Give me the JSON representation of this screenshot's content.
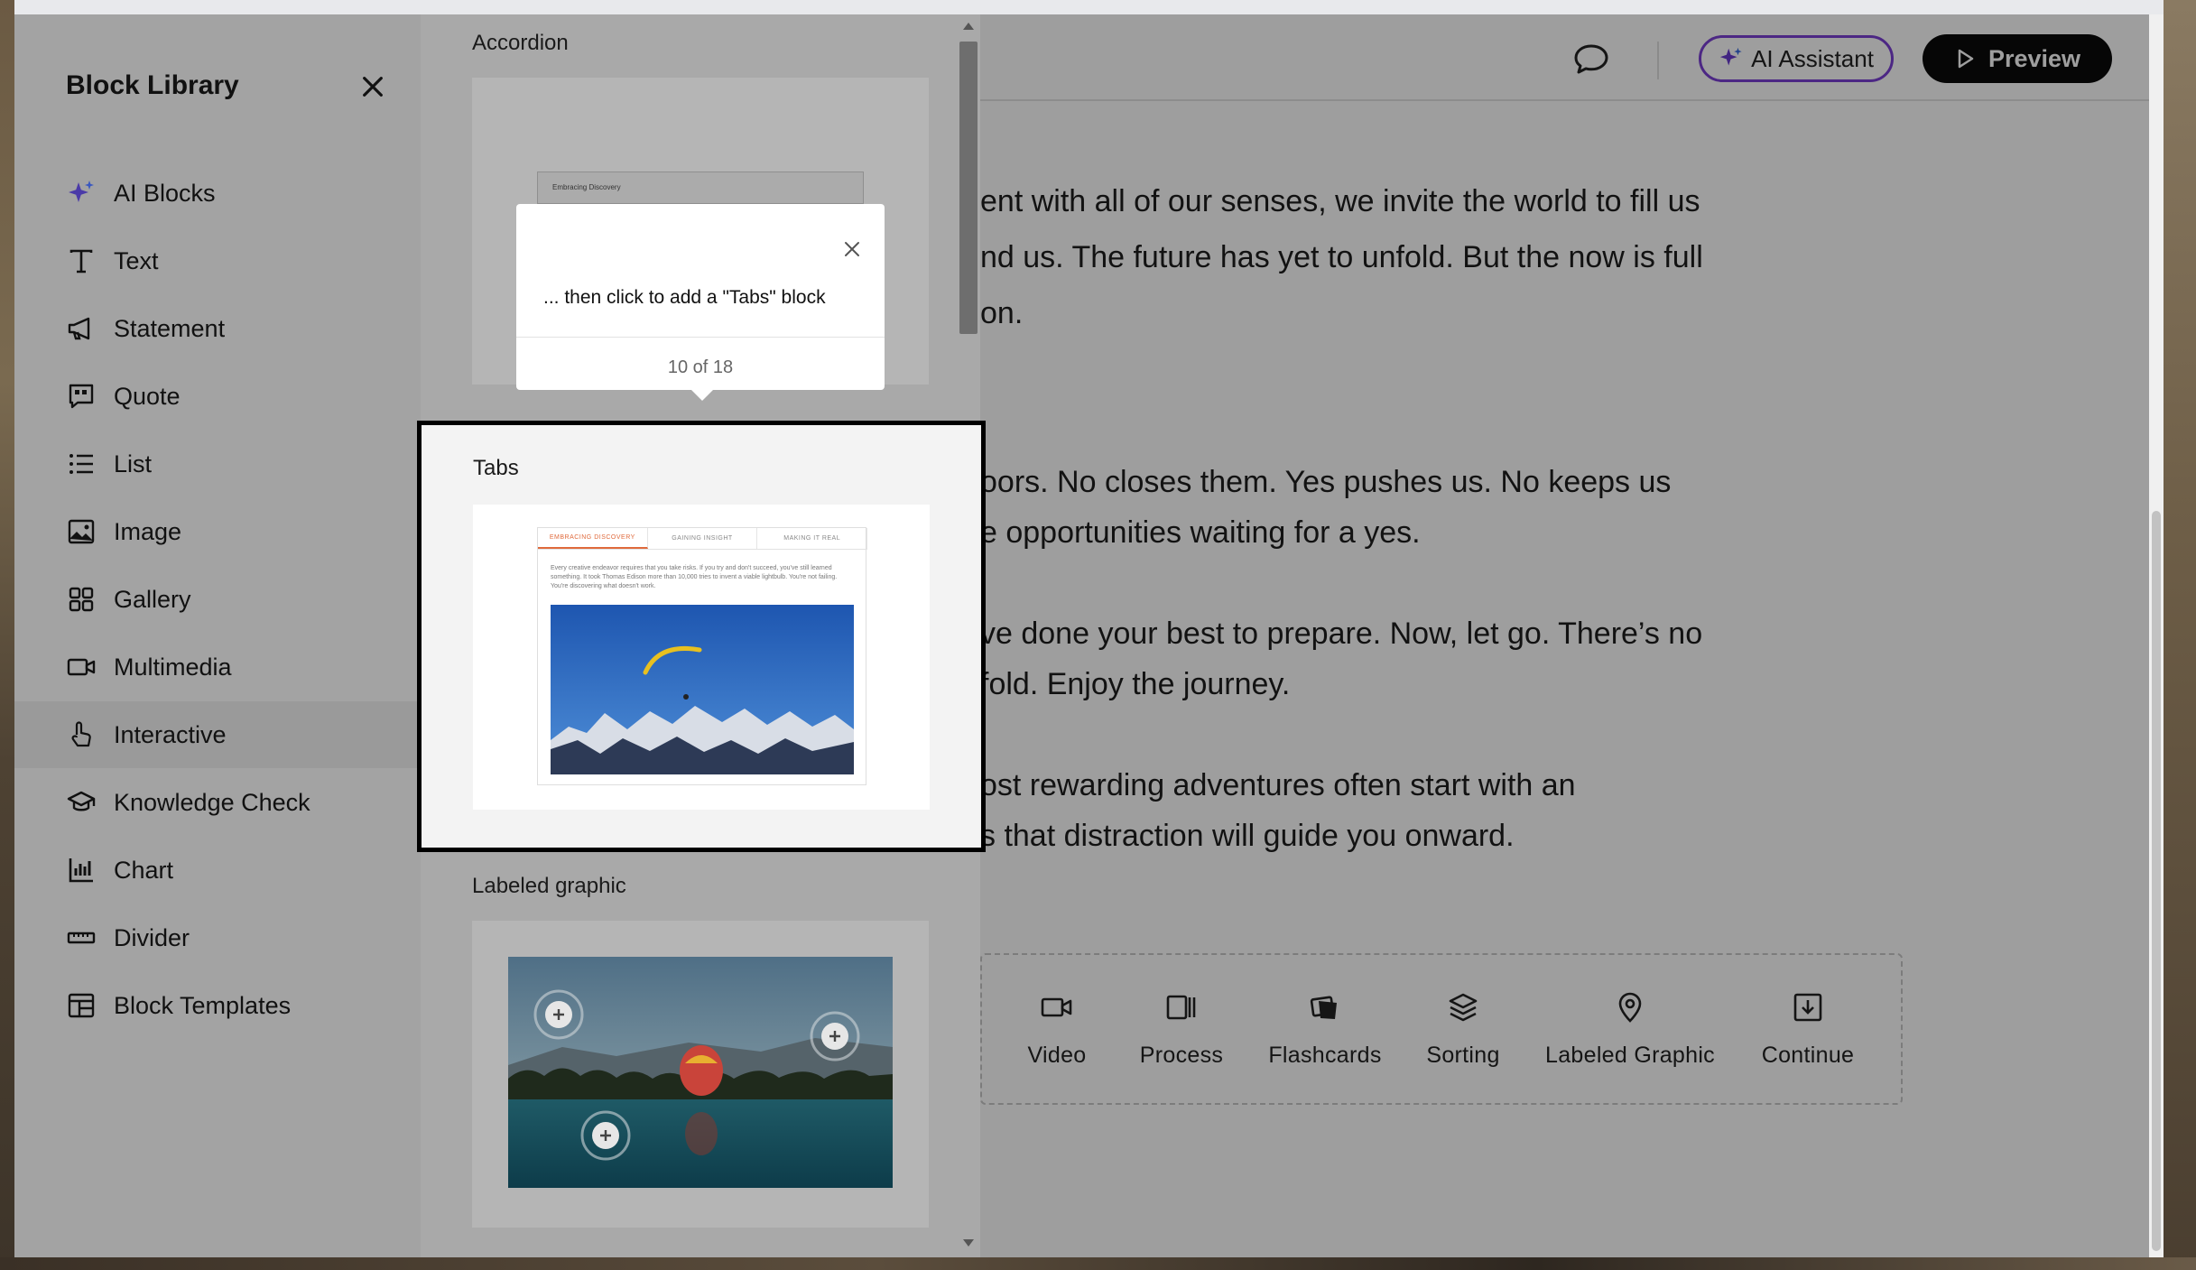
{
  "header": {
    "ai_assistant_label": "AI Assistant",
    "preview_label": "Preview"
  },
  "content": {
    "paragraph1": [
      "ent with all of our senses, we invite the world to fill us",
      "nd us. The future has yet to unfold. But the now is full",
      "on."
    ],
    "paragraph2": [
      "oors. No closes them. Yes pushes us. No keeps us",
      "e opportunities waiting for a yes."
    ],
    "paragraph3": [
      "ve done your best to prepare. Now, let go. There’s no",
      "fold. Enjoy the journey."
    ],
    "paragraph4": [
      "ost rewarding adventures often start with an",
      "s that distraction will guide you onward."
    ]
  },
  "quick_blocks": [
    {
      "label": "Video",
      "icon": "video-icon"
    },
    {
      "label": "Process",
      "icon": "process-icon"
    },
    {
      "label": "Flashcards",
      "icon": "flashcards-icon"
    },
    {
      "label": "Sorting",
      "icon": "sorting-icon"
    },
    {
      "label": "Labeled Graphic",
      "icon": "map-pin-icon"
    },
    {
      "label": "Continue",
      "icon": "continue-icon"
    }
  ],
  "sidebar": {
    "title": "Block Library",
    "items": [
      {
        "label": "AI Blocks",
        "icon": "sparkle-icon"
      },
      {
        "label": "Text",
        "icon": "text-icon"
      },
      {
        "label": "Statement",
        "icon": "megaphone-icon"
      },
      {
        "label": "Quote",
        "icon": "quote-icon"
      },
      {
        "label": "List",
        "icon": "list-icon"
      },
      {
        "label": "Image",
        "icon": "image-icon"
      },
      {
        "label": "Gallery",
        "icon": "gallery-icon"
      },
      {
        "label": "Multimedia",
        "icon": "video-icon"
      },
      {
        "label": "Interactive",
        "icon": "pointer-icon",
        "active": true
      },
      {
        "label": "Knowledge Check",
        "icon": "graduation-cap-icon"
      },
      {
        "label": "Chart",
        "icon": "chart-icon"
      },
      {
        "label": "Divider",
        "icon": "divider-icon"
      },
      {
        "label": "Block Templates",
        "icon": "template-icon"
      }
    ]
  },
  "panel": {
    "accordion_label": "Accordion",
    "accordion_row_text": "Embracing Discovery",
    "tabs_label": "Tabs",
    "tabs_preview": {
      "tabs": [
        "EMBRACING DISCOVERY",
        "GAINING INSIGHT",
        "MAKING IT REAL"
      ],
      "text": "Every creative endeavor requires that you take risks. If you try and don't succeed, you've still learned something. It took Thomas Edison more than 10,000 tries to invent a viable lightbulb. You're not failing. You're discovering what doesn't work."
    },
    "labeled_graphic_label": "Labeled graphic"
  },
  "tooltip": {
    "text": "... then click to add a \"Tabs\" block",
    "counter": "10 of 18"
  },
  "colors": {
    "ai_accent": "#7b3fd6",
    "tab_accent": "#e06a3c",
    "preview_bg": "#0a0a0a"
  }
}
